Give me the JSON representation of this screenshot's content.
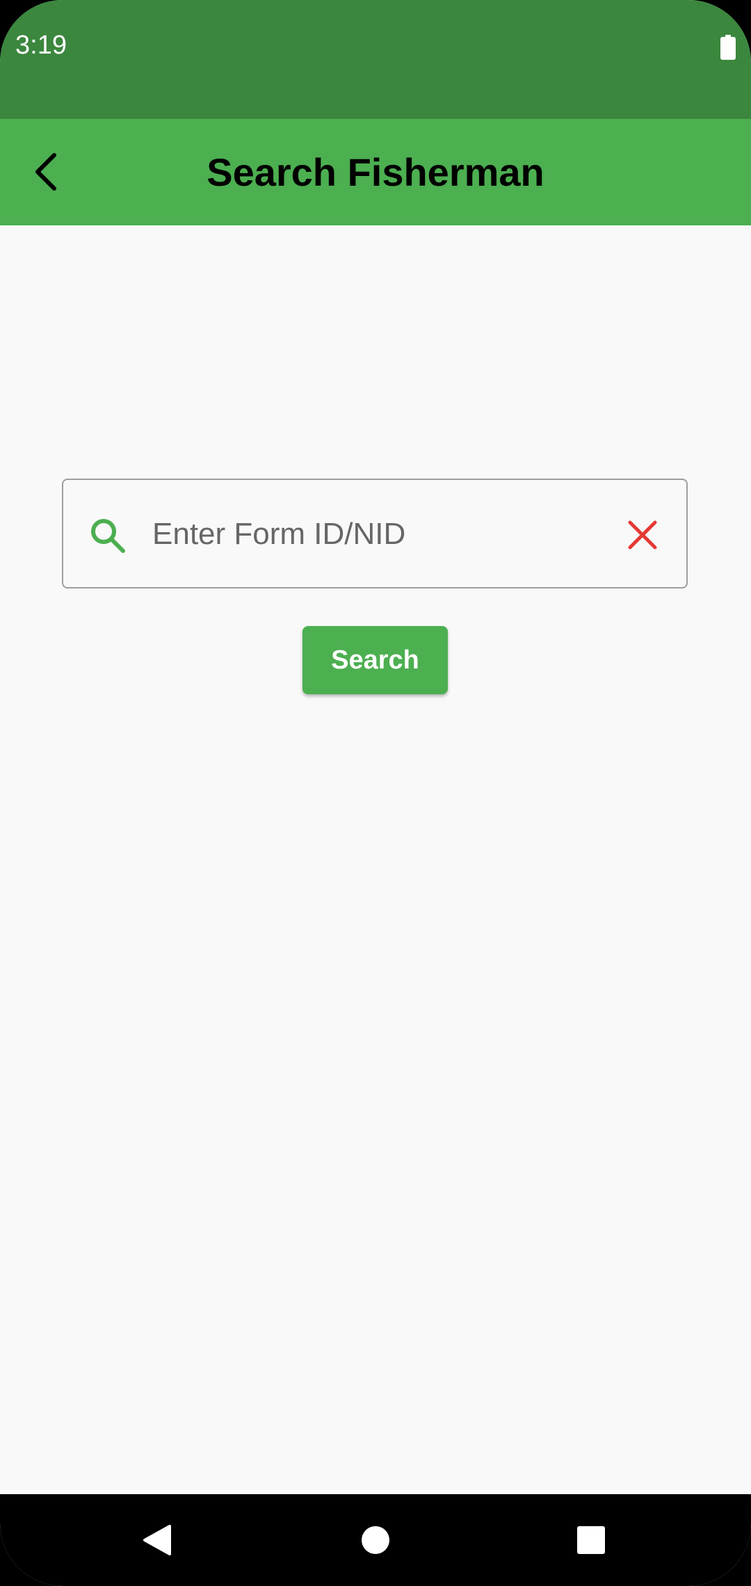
{
  "status_bar": {
    "time": "3:19",
    "battery_icon": "battery-icon",
    "background": "#3b873e"
  },
  "app_bar": {
    "title": "Search Fisherman",
    "back_icon": "chevron-left-icon",
    "background": "#4caf50"
  },
  "search": {
    "icon": "search-icon",
    "icon_color": "#4caf50",
    "placeholder": "Enter Form ID/NID",
    "value": "",
    "clear_icon": "close-icon",
    "clear_color": "#e53935",
    "button_label": "Search",
    "button_color": "#4caf50"
  },
  "nav_bar": {
    "back_icon": "nav-back-icon",
    "home_icon": "nav-home-icon",
    "recents_icon": "nav-recents-icon"
  }
}
